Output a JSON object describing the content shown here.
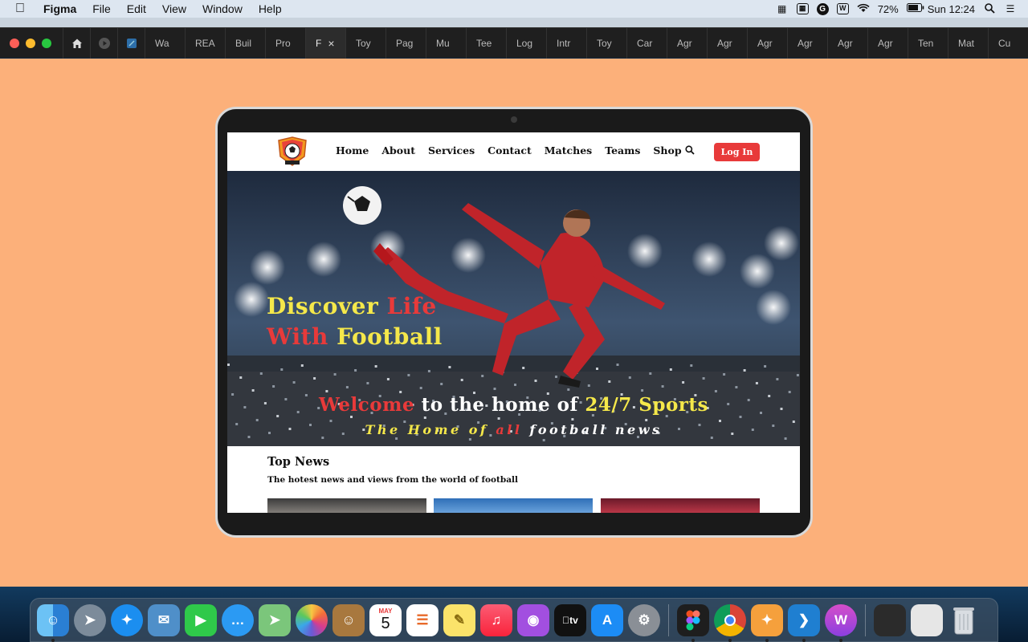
{
  "menubar": {
    "app_name": "Figma",
    "menus": [
      "File",
      "Edit",
      "View",
      "Window",
      "Help"
    ],
    "battery": "72%",
    "clock": "Sun 12:24"
  },
  "tabs": [
    "Wa",
    "REA",
    "Buil",
    "Pro",
    "F",
    "Toy",
    "Pag",
    "Mu",
    "Tee",
    "Log",
    "Intr",
    "Toy",
    "Car",
    "Agr",
    "Agr",
    "Agr",
    "Agr",
    "Agr",
    "Agr",
    "Ten",
    "Mat",
    "Cu"
  ],
  "active_tab_index": 4,
  "site": {
    "nav": [
      "Home",
      "About",
      "Services",
      "Contact",
      "Matches",
      "Teams",
      "Shop"
    ],
    "login_label": "Log In",
    "hero_line1": [
      "Discover ",
      "Life"
    ],
    "hero_line2": [
      "With ",
      "Football"
    ],
    "welcome": [
      "Welcome",
      " to the home of ",
      "24/7 Sports"
    ],
    "tagline": [
      "The Home of ",
      "all",
      " football news"
    ],
    "news_title": "Top News",
    "news_subtitle": "The hotest news and views from the world of football"
  },
  "dock": {
    "calendar_month": "MAY",
    "calendar_day": "5",
    "tv_label": "tv"
  },
  "colors": {
    "canvas": "#fcb07a",
    "accent_red": "#e83a3a",
    "accent_yellow": "#f5e84a"
  }
}
